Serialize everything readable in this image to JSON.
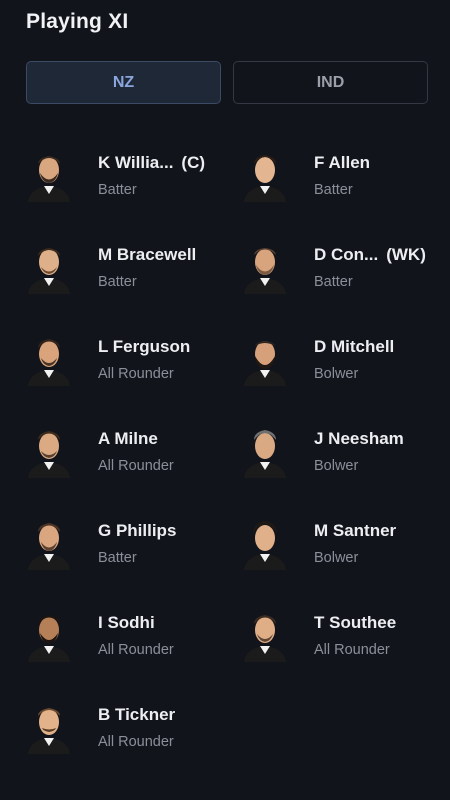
{
  "header": {
    "title": "Playing XI"
  },
  "tabs": [
    {
      "label": "NZ",
      "active": true
    },
    {
      "label": "IND",
      "active": false
    }
  ],
  "players": [
    {
      "name": "K Willia...",
      "tag": "(C)",
      "role": "Batter",
      "avatar_icon": "player-avatar-icon"
    },
    {
      "name": "F Allen",
      "tag": "",
      "role": "Batter",
      "avatar_icon": "player-avatar-icon"
    },
    {
      "name": "M Bracewell",
      "tag": "",
      "role": "Batter",
      "avatar_icon": "player-avatar-icon"
    },
    {
      "name": "D Con...",
      "tag": "(WK)",
      "role": "Batter",
      "avatar_icon": "player-avatar-icon"
    },
    {
      "name": "L Ferguson",
      "tag": "",
      "role": "All Rounder",
      "avatar_icon": "player-avatar-icon"
    },
    {
      "name": "D Mitchell",
      "tag": "",
      "role": "Bolwer",
      "avatar_icon": "player-avatar-icon"
    },
    {
      "name": "A Milne",
      "tag": "",
      "role": "All Rounder",
      "avatar_icon": "player-avatar-icon"
    },
    {
      "name": "J Neesham",
      "tag": "",
      "role": "Bolwer",
      "avatar_icon": "player-avatar-icon"
    },
    {
      "name": "G Phillips",
      "tag": "",
      "role": "Batter",
      "avatar_icon": "player-avatar-icon"
    },
    {
      "name": "M Santner",
      "tag": "",
      "role": "Bolwer",
      "avatar_icon": "player-avatar-icon"
    },
    {
      "name": "I Sodhi",
      "tag": "",
      "role": "All Rounder",
      "avatar_icon": "player-avatar-icon"
    },
    {
      "name": "T Southee",
      "tag": "",
      "role": "All Rounder",
      "avatar_icon": "player-avatar-icon"
    },
    {
      "name": "B Tickner",
      "tag": "",
      "role": "All Rounder",
      "avatar_icon": "player-avatar-icon"
    }
  ],
  "colors": {
    "background": "#12141b",
    "tab_active_bg": "#1f2837",
    "tab_active_text": "#8aa6dd",
    "role_text": "#8b8f99"
  }
}
